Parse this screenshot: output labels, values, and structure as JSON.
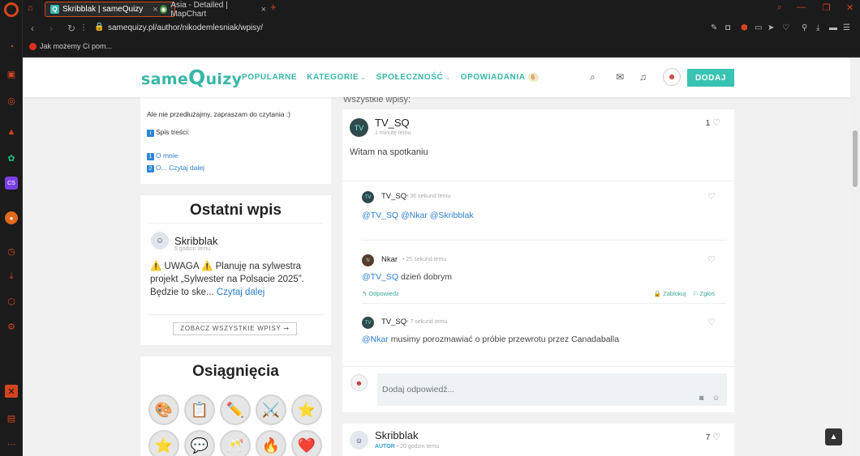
{
  "browser": {
    "tabs": [
      {
        "title": "Skribblak | sameQuizy",
        "fav": "Q"
      },
      {
        "title": "Asia - Detailed | MapChart",
        "fav": "◉"
      }
    ],
    "new_tab_glyph": "+",
    "url": "samequizy.pl/author/nikodemlesniak/wpisy/",
    "bookmark": "Jak możemy Ci pom..."
  },
  "site": {
    "logo": {
      "pre": "same",
      "q": "Q",
      "post": "uizy"
    },
    "nav": {
      "popularne": "POPULARNE",
      "kategorie": "KATEGORIE",
      "spolecznosc": "SPOŁECZNOŚĆ",
      "opowiadania": "OPOWIADANIA",
      "opowiadania_badge": "6"
    },
    "dodaj": "DODAJ"
  },
  "left": {
    "prev_post": {
      "line1": "Ale nie przedłużajmy, zapraszam do czytania :)",
      "toc_label": "Spis treści:",
      "toc1_num": "1",
      "toc1": "O mnie",
      "toc2_num": "2",
      "toc2": "O...",
      "read_more": "Czytaj dalej"
    },
    "recent": {
      "title": "Ostatni wpis",
      "user": "Skribblak",
      "when": "5 godzin temu",
      "text": "⚠️ UWAGA ⚠️ Planuję na sylwestra projekt „Sylwester na Polsacie 2025”. Będzie to ske...",
      "read_more": "Czytaj dalej",
      "see_all": "ZOBACZ WSZYSTKIE WPISY ➞"
    },
    "achievements": {
      "title": "Osiągnięcia",
      "items": [
        "🎨",
        "📋",
        "✏️",
        "⚔️",
        "⭐",
        "⭐",
        "💬",
        "🥂",
        "🔥",
        "❤️"
      ]
    }
  },
  "feed": {
    "label": "Wszystkie wpisy:",
    "post1": {
      "author": "TV_SQ",
      "when": "1 minutę temu",
      "likes": "1",
      "text": "Witam na spotkaniu",
      "replies": [
        {
          "author": "TV_SQ",
          "when": "36 sekund temu",
          "text": "@TV_SQ @Nkar @Skribblak",
          "mentions_only": true
        },
        {
          "author": "Nkar",
          "when": "25 sekund temu",
          "mention": "@TV_SQ",
          "text": " dzień dobrym",
          "reply_label": "Odpowiedz",
          "block_label": "Zablokuj",
          "report_label": "Zgłoś"
        },
        {
          "author": "TV_SQ",
          "when": "7 sekund temu",
          "mention": "@Nkar",
          "text": " musimy porozmawiać o próbie przewrotu przez Canadaballa"
        }
      ],
      "reply_placeholder": "Dodaj odpowiedź..."
    },
    "post2": {
      "author": "Skribblak",
      "role": "AUTOR",
      "when": "20 godzin temu",
      "likes": "7"
    }
  }
}
